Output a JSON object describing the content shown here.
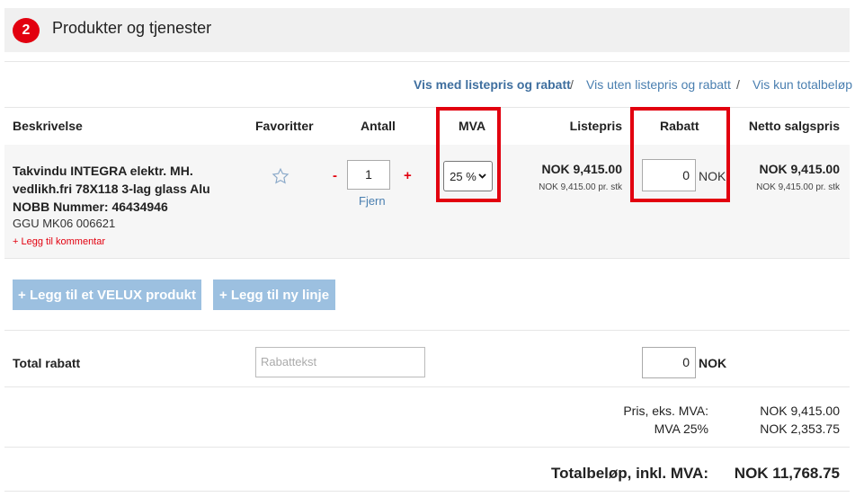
{
  "section": {
    "step": "2",
    "title": "Produkter og tjenester"
  },
  "view_options": {
    "items": [
      "Vis med listepris og rabatt",
      "Vis uten listepris og rabatt",
      "Vis kun totalbeløp"
    ],
    "separator": "/",
    "active": "Vis med listepris og rabatt"
  },
  "table": {
    "headers": {
      "description": "Beskrivelse",
      "favorites": "Favoritter",
      "quantity": "Antall",
      "vat": "MVA",
      "list_price": "Listepris",
      "discount": "Rabatt",
      "net_price": "Netto salgspris"
    },
    "row": {
      "description_line1": "Takvindu INTEGRA elektr. MH.",
      "description_line2": "vedlikh.fri 78X118 3-lag glass Alu",
      "description_line3": "NOBB Nummer: 46434946",
      "code": "GGU MK06 006621",
      "add_comment": "+ Legg til kommentar",
      "qty_minus": "-",
      "qty_value": "1",
      "qty_plus": "+",
      "remove": "Fjern",
      "vat_selected": "25 %",
      "list_price": "NOK 9,415.00",
      "list_price_unit": "NOK 9,415.00 pr. stk",
      "discount_value": "0",
      "discount_unit": "NOK",
      "net_price": "NOK 9,415.00",
      "net_price_unit": "NOK 9,415.00 pr. stk"
    }
  },
  "buttons": {
    "add_velux": "+ Legg til et VELUX produkt",
    "add_line": "+ Legg til ny linje"
  },
  "total_discount": {
    "label": "Total rabatt",
    "text_placeholder": "Rabattekst",
    "value": "0",
    "unit": "NOK"
  },
  "summary": {
    "price_ex_vat_label": "Pris, eks. MVA:",
    "price_ex_vat": "NOK 9,415.00",
    "vat_label": "MVA 25%",
    "vat": "NOK 2,353.75",
    "total_label": "Totalbeløp, inkl. MVA:",
    "total": "NOK 11,768.75"
  },
  "colors": {
    "accent_red": "#e2000f",
    "link_blue": "#4a7fb0",
    "button_blue": "#9cc0e0"
  }
}
